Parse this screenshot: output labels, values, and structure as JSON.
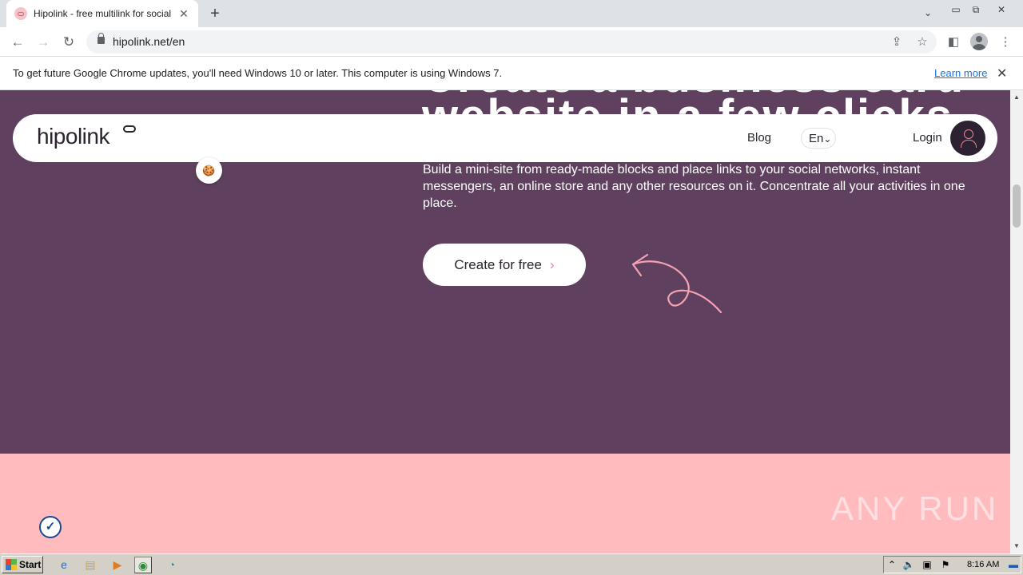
{
  "browser": {
    "tab_title": "Hipolink - free multilink for social netw",
    "tab_close": "✕",
    "new_tab": "+",
    "url": "hipolink.net/en"
  },
  "infobar": {
    "message": "To get future Google Chrome updates, you'll need Windows 10 or later. This computer is using Windows 7.",
    "link": "Learn more",
    "close": "✕"
  },
  "header": {
    "logo": "hipolink",
    "blog": "Blog",
    "lang": "En",
    "lang_caret": "⌄",
    "login": "Login"
  },
  "hero": {
    "title_line1": "Create a business card",
    "title_line2": "website in a few clicks",
    "description": "Build a mini-site from ready-made blocks and place links to your social networks, instant messengers, an online store and any other resources on it. Concentrate all your activities in one place.",
    "cta": "Create for free",
    "cta_chevron": "›"
  },
  "watermark": "ANY RUN",
  "taskbar": {
    "start": "Start",
    "clock": "8:16 AM"
  },
  "colors": {
    "hero_bg": "#5f405e",
    "pink_section": "#ffbbbe",
    "accent": "#ef8097"
  },
  "icons": [
    "lock-icon",
    "share-icon",
    "star-icon",
    "sidepanel-icon",
    "profile-icon",
    "menu-icon",
    "arrow-doodle",
    "cookie-icon",
    "verified-badge-icon"
  ]
}
